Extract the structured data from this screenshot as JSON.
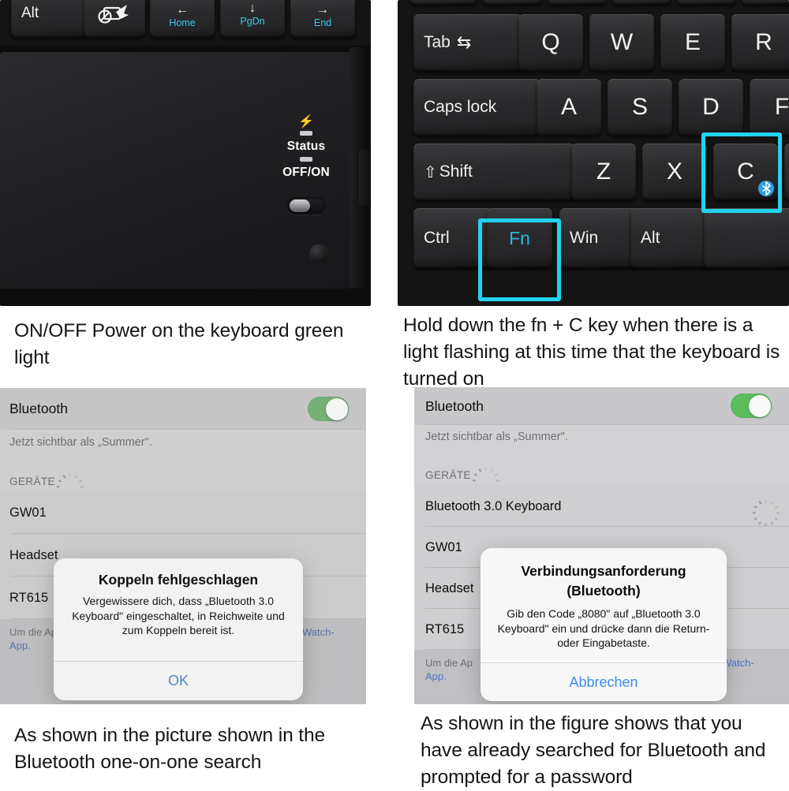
{
  "panels": {
    "top_left": {
      "name": "keyboard-power-switch-photo",
      "keys": [
        {
          "label": "Alt",
          "sub": ""
        },
        {
          "label": "",
          "sub": "",
          "icon": "touchpad-disable-icon"
        },
        {
          "label": "←",
          "sub": "Home"
        },
        {
          "label": "↓",
          "sub": "PgDn"
        },
        {
          "label": "→",
          "sub": "End"
        }
      ],
      "status": {
        "charge_icon": "charging-bolt-icon",
        "status_label": "Status",
        "power_label": "OFF/ON"
      }
    },
    "top_right": {
      "name": "keyboard-fn-c-photo",
      "rows": [
        [
          {
            "label": "Tab",
            "glyph": "⇆"
          },
          {
            "label": "Q"
          },
          {
            "label": "W"
          },
          {
            "label": "E"
          },
          {
            "label": "R"
          }
        ],
        [
          {
            "label": "Caps lock"
          },
          {
            "label": "A"
          },
          {
            "label": "S"
          },
          {
            "label": "D"
          },
          {
            "label": "F"
          }
        ],
        [
          {
            "label": "Shift",
            "glyph": "⇧"
          },
          {
            "label": "Z"
          },
          {
            "label": "X"
          },
          {
            "label": "C",
            "badge": "bluetooth-icon"
          }
        ],
        [
          {
            "label": "Ctrl"
          },
          {
            "label": "Fn",
            "accent": true
          },
          {
            "label": "Win"
          },
          {
            "label": "Alt"
          }
        ]
      ],
      "highlighted_keys": [
        "C",
        "Fn"
      ]
    },
    "bottom_left": {
      "name": "bluetooth-settings-pairing-failed",
      "title": "Bluetooth",
      "toggle_on": true,
      "visibility": "Jetzt sichtbar als „Summer\".",
      "devices_header": "GERÄTE",
      "devices": [
        "GW01",
        "Headset",
        "RT615"
      ],
      "footer_text": "Um die Ap",
      "footer_text2": "App.",
      "footer_link": "Watch-",
      "alert": {
        "title": "Koppeln fehlgeschlagen",
        "message": "Vergewissere dich, dass „Bluetooth 3.0 Keyboard\" eingeschaltet, in Reichweite und zum Koppeln bereit ist.",
        "button": "OK"
      }
    },
    "bottom_right": {
      "name": "bluetooth-settings-pairing-request",
      "title": "Bluetooth",
      "toggle_on": true,
      "visibility": "Jetzt sichtbar als „Summer\".",
      "devices_header": "GERÄTE",
      "devices": [
        "Bluetooth 3.0 Keyboard",
        "GW01",
        "Headset",
        "RT615"
      ],
      "footer_text": "Um die Ap",
      "footer_text2": "App.",
      "footer_link": "Watch-",
      "alert": {
        "title_line1": "Verbindungsanforderung",
        "title_line2": "(Bluetooth)",
        "message": "Gib den Code „8080\" auf „Bluetooth 3.0 Keyboard\" ein und drücke dann die Return- oder Eingabetaste.",
        "button": "Abbrechen"
      }
    }
  },
  "captions": {
    "top_left": "ON/OFF Power on the keyboard green light",
    "top_right": "Hold down the fn + C key when there is a light flashing at this time that the keyboard is turned on",
    "bottom_left": "As shown in the picture shown in the Bluetooth one-on-one search",
    "bottom_right": "As shown in the figure shows that you have already searched for Bluetooth and prompted for a password"
  },
  "colors": {
    "highlight": "#22d3ee",
    "key_accent": "#2fb6dd",
    "toggle_green": "#5cbd5c",
    "ios_link": "#3f8cf0",
    "bluetooth_blue": "#2f9fe0"
  }
}
